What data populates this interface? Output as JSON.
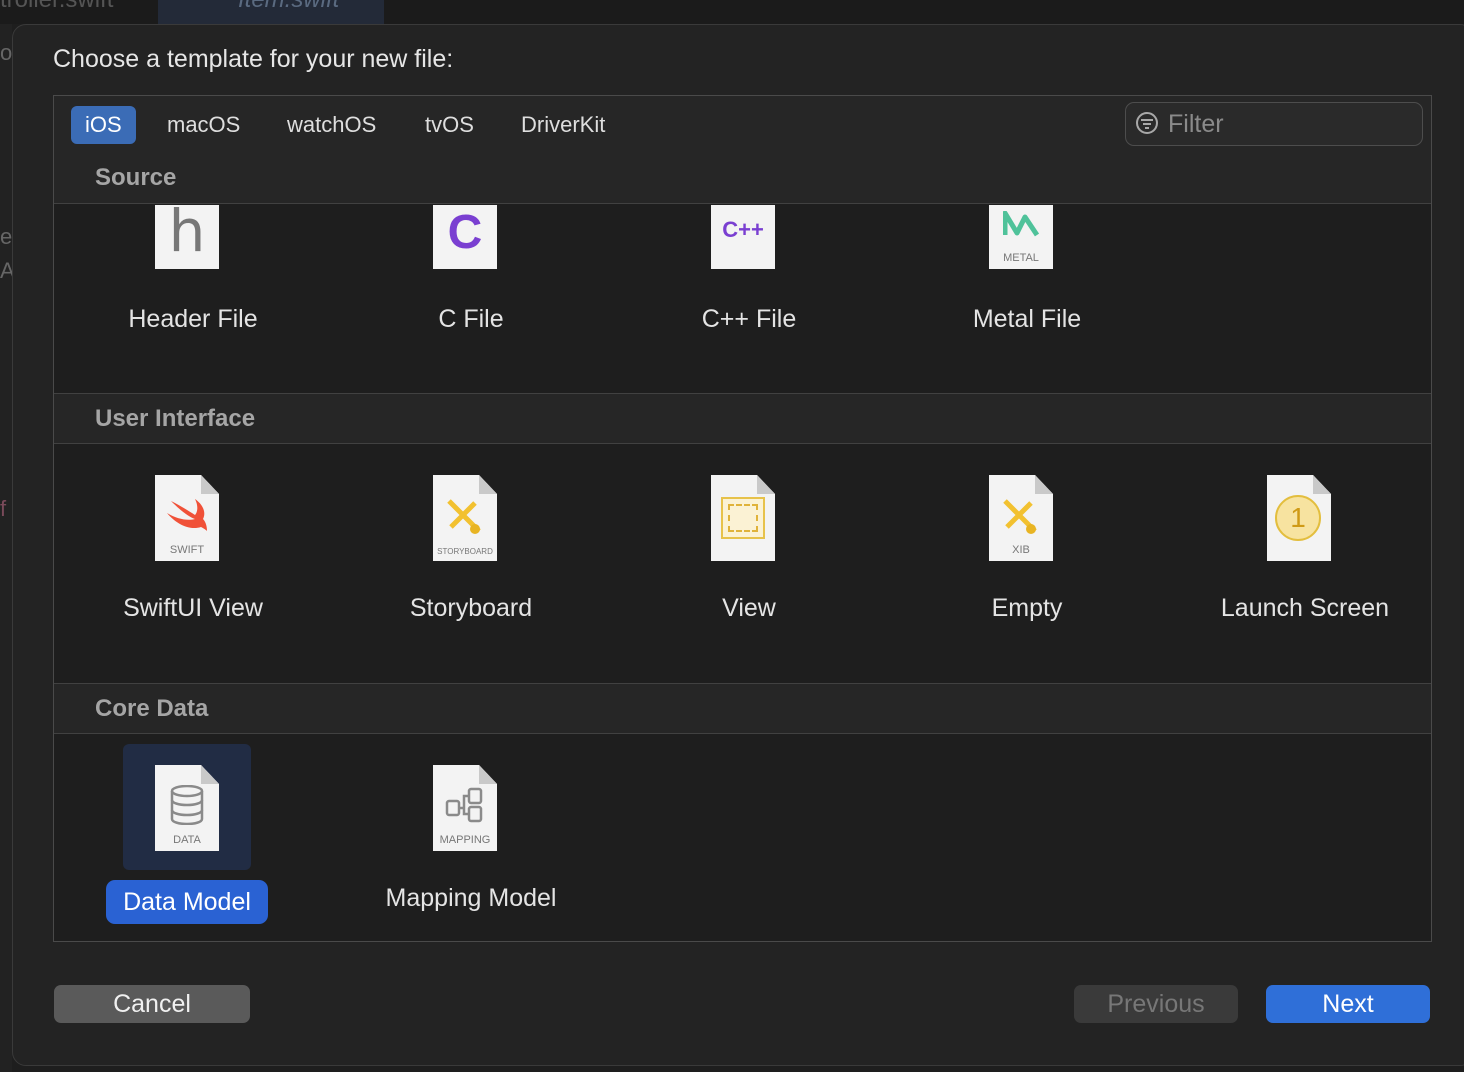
{
  "background": {
    "tab1": "troller.swift",
    "tab2": "Item.swift",
    "gutter_glyphs": [
      "o",
      "e",
      "A",
      "f"
    ]
  },
  "dialog": {
    "title": "Choose a template for your new file:",
    "platform_tabs": [
      {
        "label": "iOS",
        "active": true
      },
      {
        "label": "macOS",
        "active": false
      },
      {
        "label": "watchOS",
        "active": false
      },
      {
        "label": "tvOS",
        "active": false
      },
      {
        "label": "DriverKit",
        "active": false
      }
    ],
    "filter": {
      "placeholder": "Filter",
      "value": "",
      "icon": "filter-icon"
    },
    "sections": [
      {
        "title": "Source",
        "items": [
          {
            "label": "Header File",
            "icon": "header-file-icon",
            "glyph": "h"
          },
          {
            "label": "C File",
            "icon": "c-file-icon",
            "glyph": "C"
          },
          {
            "label": "C++ File",
            "icon": "cpp-file-icon",
            "glyph": "C++"
          },
          {
            "label": "Metal File",
            "icon": "metal-file-icon",
            "caption": "METAL"
          }
        ]
      },
      {
        "title": "User Interface",
        "items": [
          {
            "label": "SwiftUI View",
            "icon": "swift-file-icon",
            "caption": "SWIFT"
          },
          {
            "label": "Storyboard",
            "icon": "storyboard-file-icon",
            "caption": "STORYBOARD"
          },
          {
            "label": "View",
            "icon": "view-file-icon"
          },
          {
            "label": "Empty",
            "icon": "xib-file-icon",
            "caption": "XIB"
          },
          {
            "label": "Launch Screen",
            "icon": "launch-screen-file-icon",
            "glyph": "1"
          }
        ]
      },
      {
        "title": "Core Data",
        "items": [
          {
            "label": "Data Model",
            "icon": "data-model-file-icon",
            "caption": "DATA",
            "selected": true
          },
          {
            "label": "Mapping Model",
            "icon": "mapping-model-file-icon",
            "caption": "MAPPING"
          }
        ]
      }
    ],
    "buttons": {
      "cancel": "Cancel",
      "previous": "Previous",
      "next": "Next"
    },
    "colors": {
      "accent": "#2a62d3",
      "tab_active": "#3b6cb6",
      "next_button": "#2f6fd8"
    }
  }
}
